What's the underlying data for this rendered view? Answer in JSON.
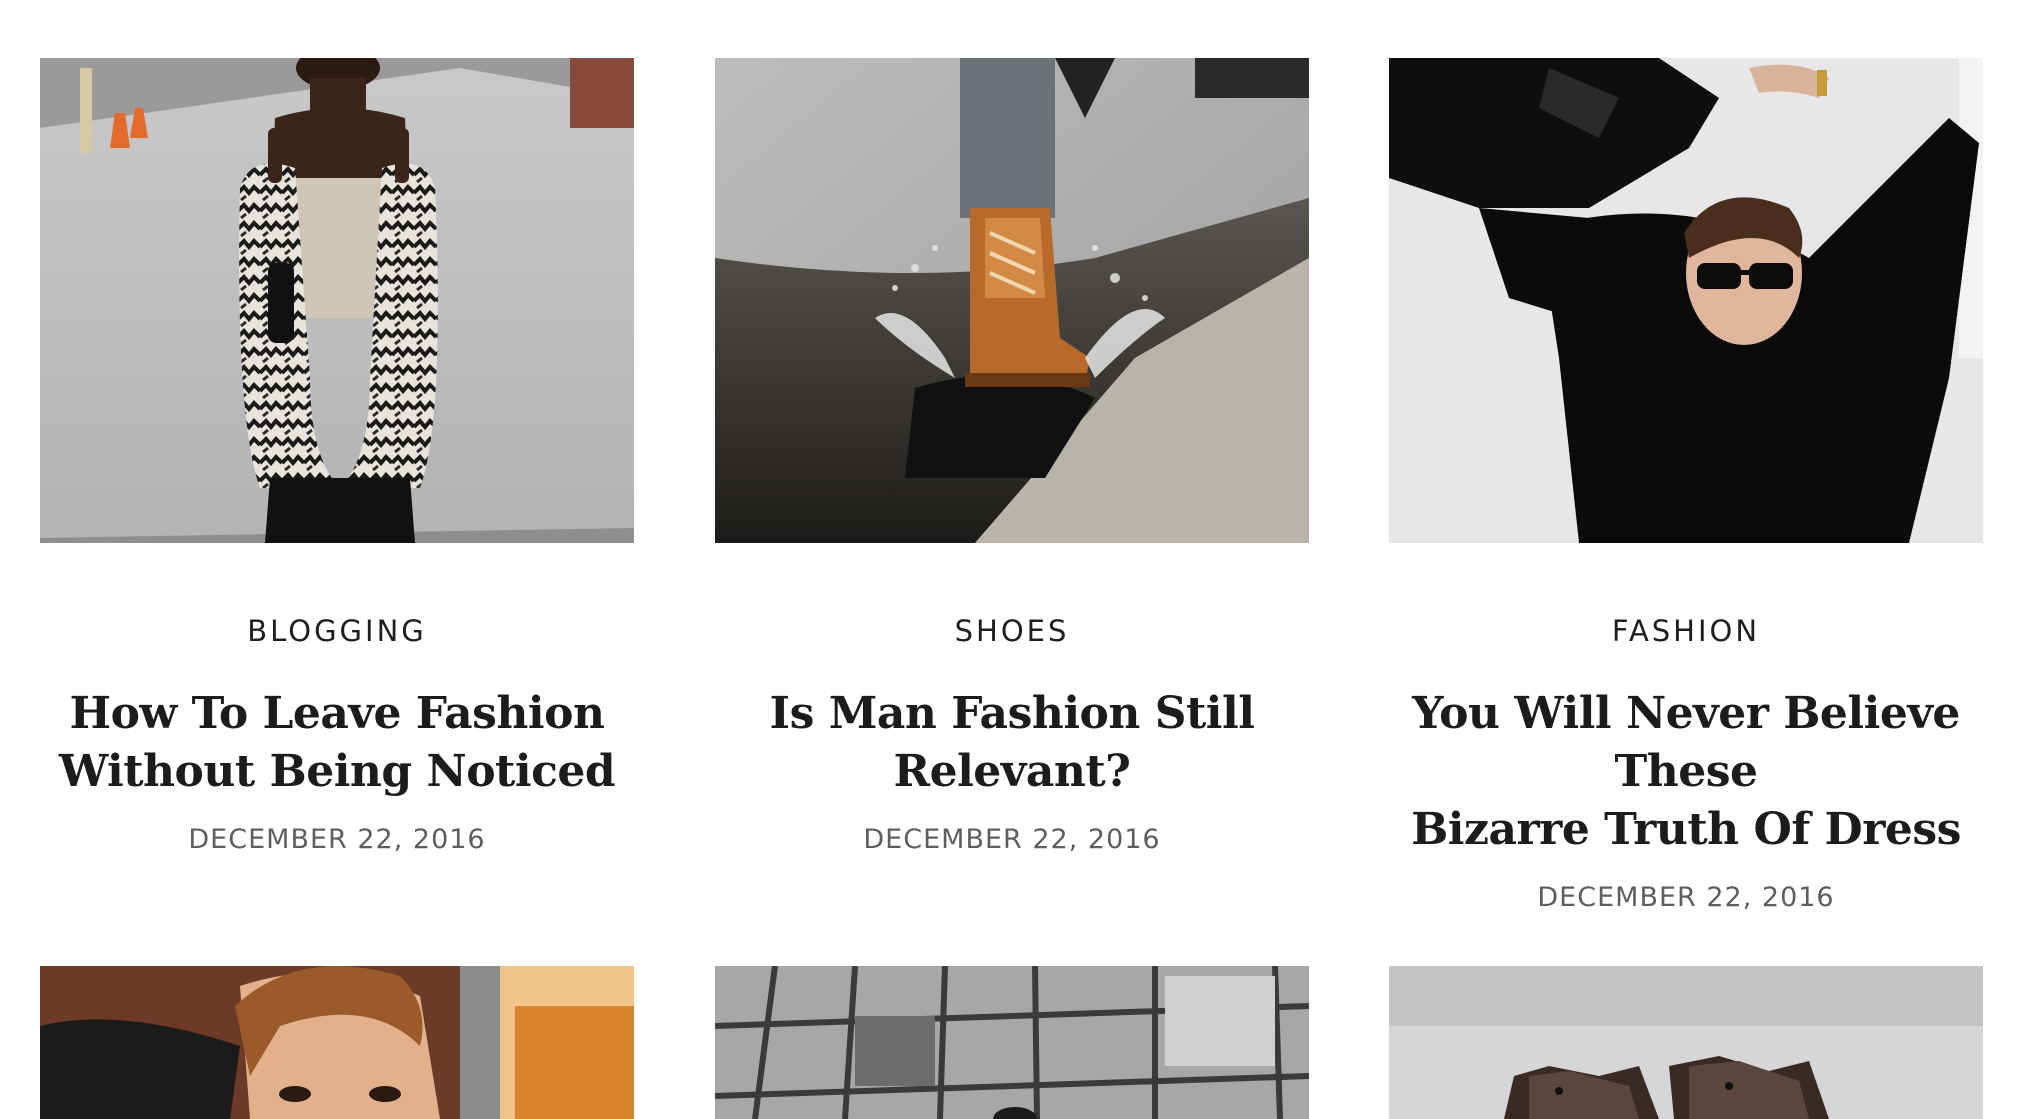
{
  "posts": [
    {
      "category": "BLOGGING",
      "title_line1": "How To Leave Fashion",
      "title_line2": "Without Being Noticed",
      "date": "DECEMBER 22, 2016",
      "image_icon": "woman-knit-cardigan-street-photo"
    },
    {
      "category": "SHOES",
      "title_line1": "Is Man Fashion Still",
      "title_line2": "Relevant?",
      "date": "DECEMBER 22, 2016",
      "image_icon": "boot-splashing-puddle-photo"
    },
    {
      "category": "FASHION",
      "title_line1": "You Will Never Believe These",
      "title_line2": "Bizarre Truth Of Dress",
      "date": "DECEMBER 22, 2016",
      "image_icon": "man-sunglasses-black-sweater-photo"
    }
  ],
  "next_row": [
    {
      "image_icon": "man-portrait-warm-photo"
    },
    {
      "image_icon": "glass-building-photo"
    },
    {
      "image_icon": "leather-boots-photo"
    }
  ],
  "colors": {
    "background": "#ffffff",
    "title": "#1c1c1c",
    "category": "#1e1e1e",
    "date": "#5e5e5e"
  }
}
